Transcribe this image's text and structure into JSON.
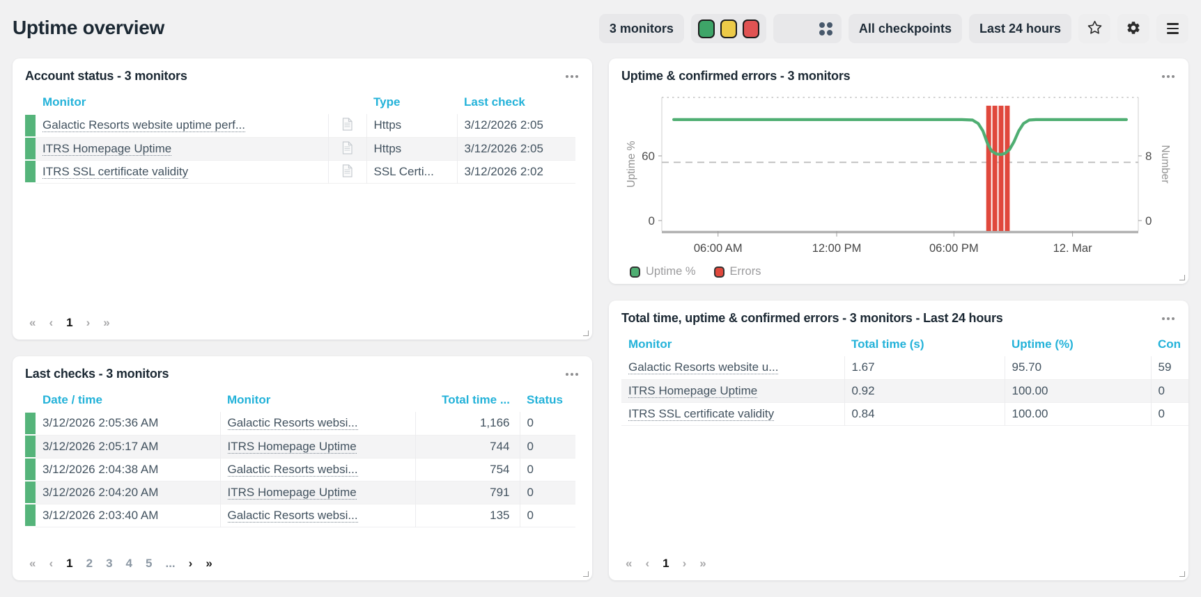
{
  "page": {
    "title": "Uptime overview"
  },
  "toolbar": {
    "monitors": "3 monitors",
    "status_colors": [
      "#3ea568",
      "#edca48",
      "#e05353"
    ],
    "checkpoints": "All checkpoints",
    "period": "Last 24 hours"
  },
  "panels": {
    "account_status": {
      "title": "Account status - 3 monitors",
      "columns": {
        "monitor": "Monitor",
        "type": "Type",
        "last_check": "Last check"
      },
      "rows": [
        {
          "status_color": "#55b47a",
          "monitor": "Galactic Resorts website uptime perf...",
          "type": "Https",
          "last_check": "3/12/2026 2:05"
        },
        {
          "status_color": "#55b47a",
          "monitor": "ITRS Homepage Uptime",
          "type": "Https",
          "last_check": "3/12/2026 2:05"
        },
        {
          "status_color": "#55b47a",
          "monitor": "ITRS SSL certificate validity",
          "type": "SSL Certi...",
          "last_check": "3/12/2026 2:02"
        }
      ],
      "pagination": [
        {
          "label": "«"
        },
        {
          "label": "‹"
        },
        {
          "label": "1",
          "current": true
        },
        {
          "label": "›"
        },
        {
          "label": "»"
        }
      ]
    },
    "last_checks": {
      "title": "Last checks - 3 monitors",
      "columns": {
        "datetime": "Date / time",
        "monitor": "Monitor",
        "total_time": "Total time ...",
        "status": "Status"
      },
      "rows": [
        {
          "status_color": "#55b47a",
          "datetime": "3/12/2026 2:05:36 AM",
          "monitor": "Galactic Resorts websi...",
          "total_time": "1,166",
          "status": "0"
        },
        {
          "status_color": "#55b47a",
          "datetime": "3/12/2026 2:05:17 AM",
          "monitor": "ITRS Homepage Uptime",
          "total_time": "744",
          "status": "0"
        },
        {
          "status_color": "#55b47a",
          "datetime": "3/12/2026 2:04:38 AM",
          "monitor": "Galactic Resorts websi...",
          "total_time": "754",
          "status": "0"
        },
        {
          "status_color": "#55b47a",
          "datetime": "3/12/2026 2:04:20 AM",
          "monitor": "ITRS Homepage Uptime",
          "total_time": "791",
          "status": "0"
        },
        {
          "status_color": "#55b47a",
          "datetime": "3/12/2026 2:03:40 AM",
          "monitor": "Galactic Resorts websi...",
          "total_time": "135",
          "status": "0"
        }
      ],
      "pagination": [
        {
          "label": "«"
        },
        {
          "label": "‹"
        },
        {
          "label": "1",
          "current": true
        },
        {
          "label": "2",
          "link": true
        },
        {
          "label": "3",
          "link": true
        },
        {
          "label": "4",
          "link": true
        },
        {
          "label": "5",
          "link": true
        },
        {
          "label": "...",
          "link": true
        },
        {
          "label": "›",
          "enabled": true
        },
        {
          "label": "»",
          "enabled": true
        }
      ]
    },
    "uptime_chart": {
      "title": "Uptime & confirmed errors - 3 monitors"
    },
    "totals": {
      "title": "Total time, uptime & confirmed errors - 3 monitors - Last 24 hours",
      "columns": {
        "monitor": "Monitor",
        "total_time": "Total time (s)",
        "uptime": "Uptime (%)",
        "confirmed": "Con"
      },
      "rows": [
        {
          "monitor": "Galactic Resorts website u...",
          "total_time": "1.67",
          "uptime": "95.70",
          "confirmed": "59"
        },
        {
          "monitor": "ITRS Homepage Uptime",
          "total_time": "0.92",
          "uptime": "100.00",
          "confirmed": "0"
        },
        {
          "monitor": "ITRS SSL certificate validity",
          "total_time": "0.84",
          "uptime": "100.00",
          "confirmed": "0"
        }
      ],
      "pagination": [
        {
          "label": "«"
        },
        {
          "label": "‹"
        },
        {
          "label": "1",
          "current": true
        },
        {
          "label": "›"
        },
        {
          "label": "»"
        }
      ]
    }
  },
  "chart_data": {
    "type": "line+bar",
    "title": "Uptime & confirmed errors - 3 monitors",
    "y_left": {
      "label": "Uptime %",
      "ticks": [
        0,
        60
      ]
    },
    "y_right": {
      "label": "Number",
      "ticks": [
        0,
        8
      ]
    },
    "x_ticks": [
      "06:00 AM",
      "12:00 PM",
      "06:00 PM",
      "12. Mar"
    ],
    "x_tick_fractions": [
      0.118,
      0.367,
      0.613,
      0.862
    ],
    "threshold_value": 54,
    "grid": false,
    "legend_position": "bottom-left",
    "series": [
      {
        "name": "Uptime %",
        "type": "line",
        "axis": "left",
        "color": "#4fae72",
        "points": [
          [
            0.025,
            93.6
          ],
          [
            0.63,
            93.6
          ],
          [
            0.652,
            93.2
          ],
          [
            0.664,
            90
          ],
          [
            0.674,
            83
          ],
          [
            0.683,
            72
          ],
          [
            0.692,
            64.5
          ],
          [
            0.702,
            61.8
          ],
          [
            0.712,
            61.2
          ],
          [
            0.721,
            62.5
          ],
          [
            0.73,
            66
          ],
          [
            0.739,
            73
          ],
          [
            0.749,
            83
          ],
          [
            0.759,
            90
          ],
          [
            0.771,
            93.2
          ],
          [
            0.785,
            93.6
          ],
          [
            0.975,
            93.6
          ]
        ]
      },
      {
        "name": "Errors",
        "type": "bar",
        "axis": "right",
        "color": "#e0483c",
        "bar_value": 14.2,
        "bar_fractions": [
          0.686,
          0.699,
          0.712,
          0.725
        ]
      }
    ],
    "legend": [
      {
        "label": "Uptime %",
        "color": "#4fae72"
      },
      {
        "label": "Errors",
        "color": "#e0483c"
      }
    ]
  }
}
